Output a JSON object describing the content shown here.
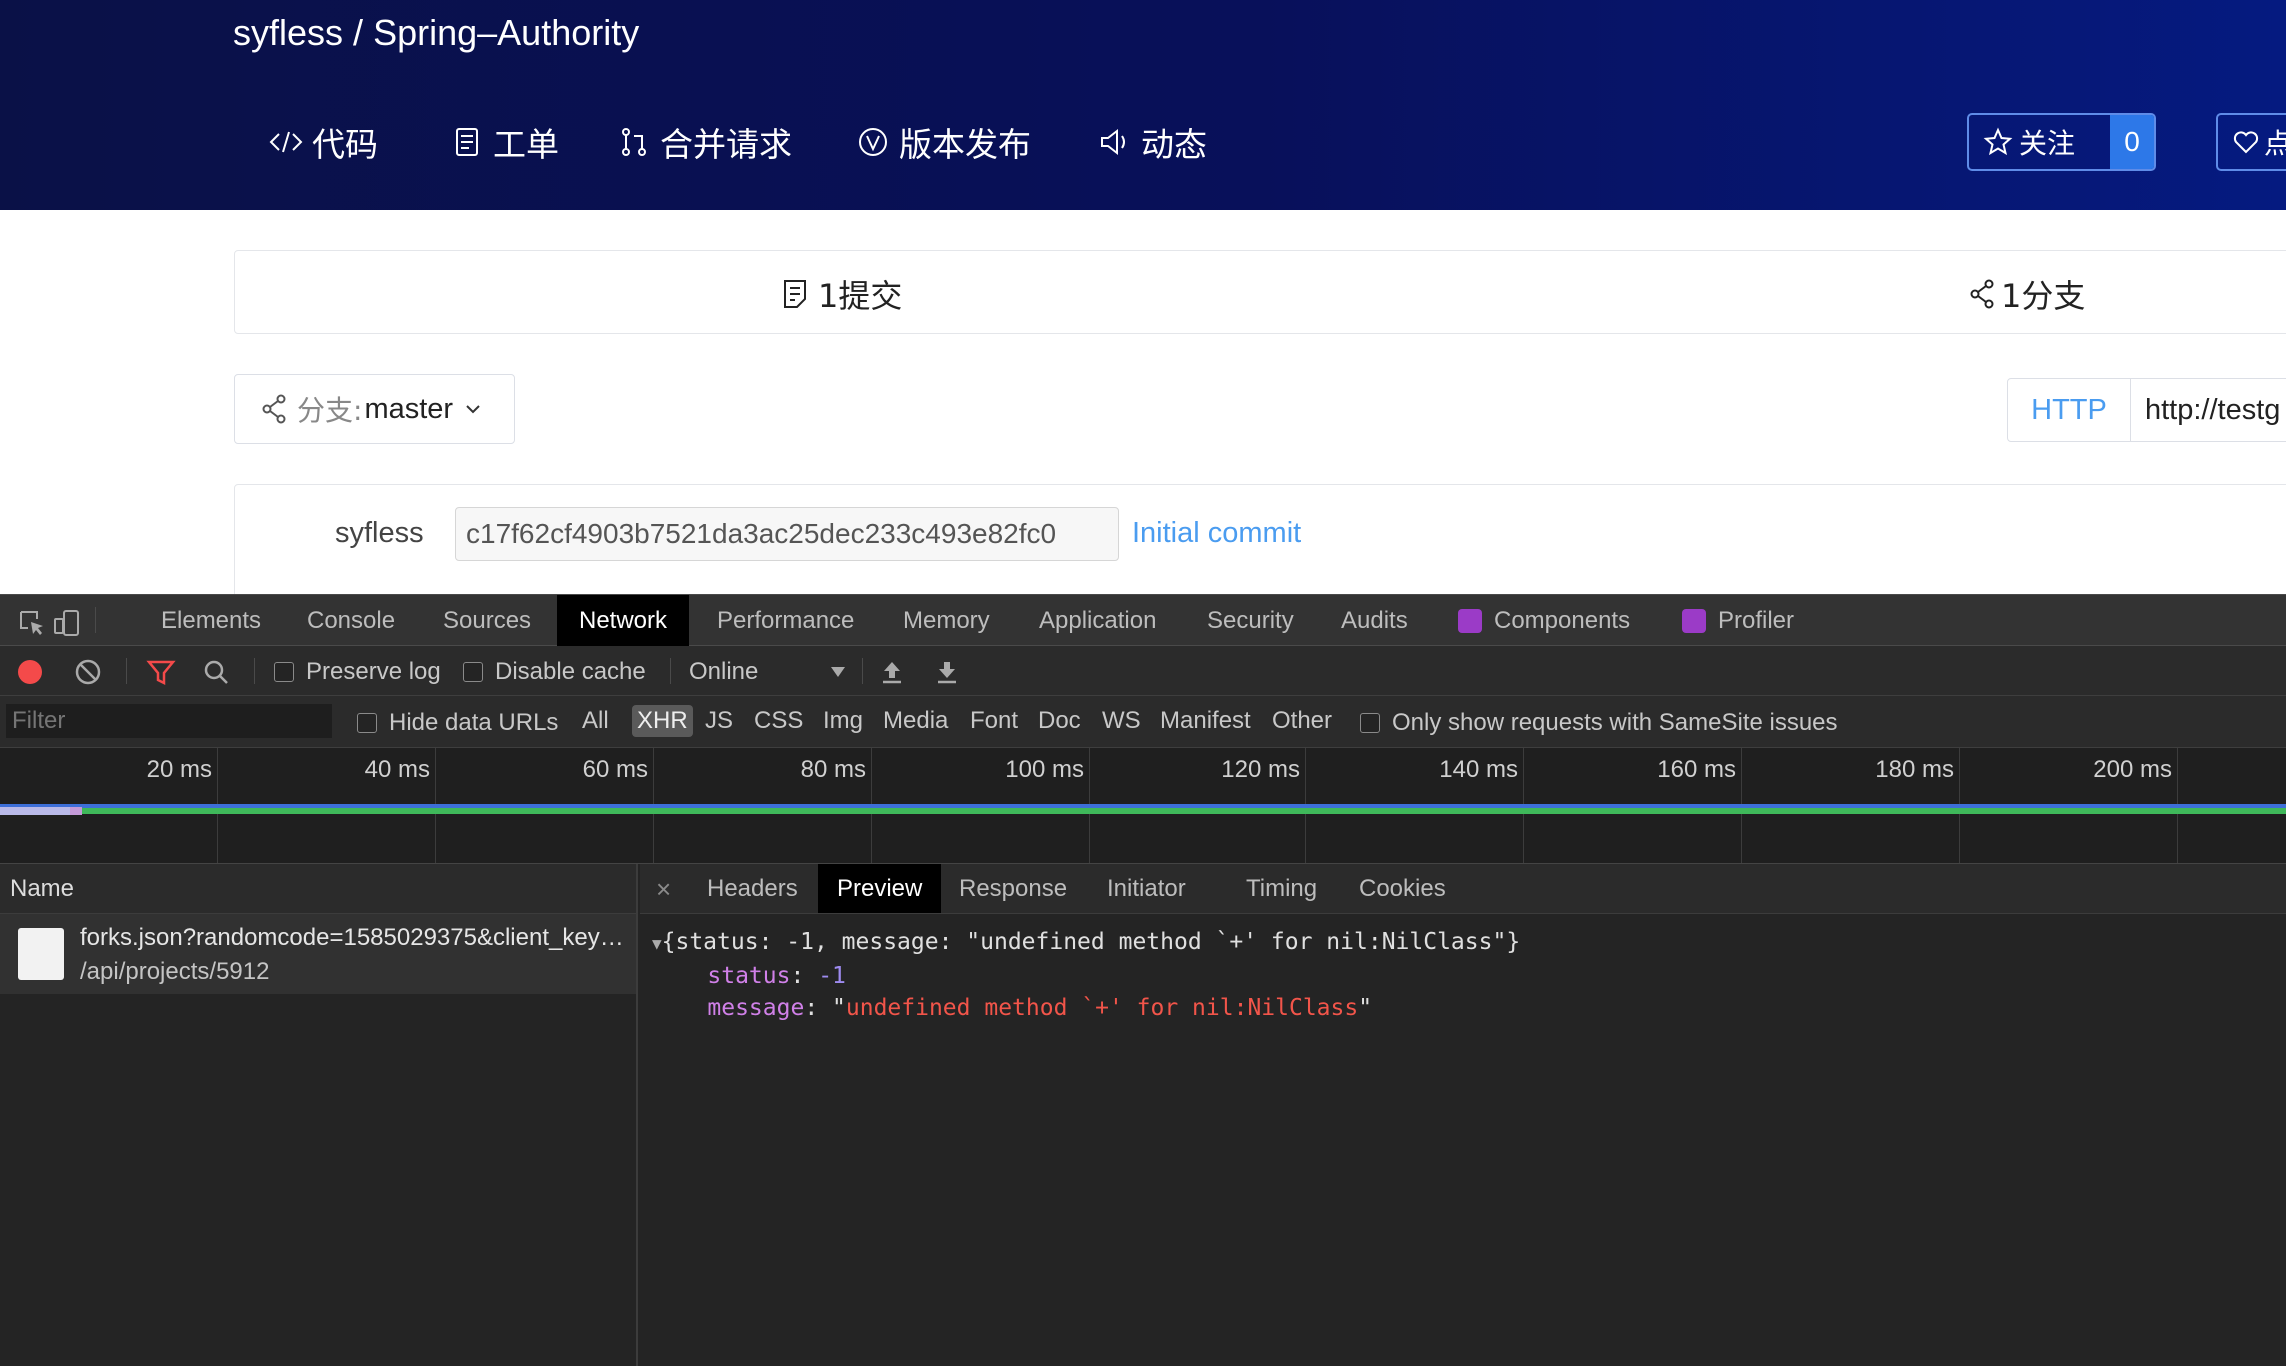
{
  "repo": {
    "owner": "syfless",
    "separator": "/",
    "name": "Spring–Authority"
  },
  "nav": [
    {
      "icon": "code-icon",
      "label": "代码"
    },
    {
      "icon": "issue-icon",
      "label": "工单"
    },
    {
      "icon": "pull-request-icon",
      "label": "合并请求"
    },
    {
      "icon": "release-icon",
      "label": "版本发布"
    },
    {
      "icon": "activity-icon",
      "label": "动态"
    }
  ],
  "watch": {
    "label": "关注",
    "count": "0"
  },
  "like": {
    "label": "点"
  },
  "stats": {
    "commits": "1提交",
    "branches": "1分支"
  },
  "branch": {
    "prefix": "分支:",
    "value": "master"
  },
  "clone": {
    "protocol": "HTTP",
    "url": "http://testg"
  },
  "commit": {
    "author": "syfless",
    "hash": "c17f62cf4903b7521da3ac25dec233c493e82fc0",
    "message": "Initial commit"
  },
  "devtools": {
    "tabs": [
      "Elements",
      "Console",
      "Sources",
      "Network",
      "Performance",
      "Memory",
      "Application",
      "Security",
      "Audits",
      "Components",
      "Profiler"
    ],
    "active_tab": "Network",
    "toolbar": {
      "preserve_log": "Preserve log",
      "disable_cache": "Disable cache",
      "throttle": "Online"
    },
    "filter": {
      "placeholder": "Filter",
      "hide_data_urls": "Hide data URLs",
      "types": [
        "All",
        "XHR",
        "JS",
        "CSS",
        "Img",
        "Media",
        "Font",
        "Doc",
        "WS",
        "Manifest",
        "Other"
      ],
      "active_type": "XHR",
      "samesite": "Only show requests with SameSite issues"
    },
    "timeline_ticks": [
      "20 ms",
      "40 ms",
      "60 ms",
      "80 ms",
      "100 ms",
      "120 ms",
      "140 ms",
      "160 ms",
      "180 ms",
      "200 ms"
    ],
    "name_header": "Name",
    "request": {
      "name": "forks.json?randomcode=1585029375&client_key=...",
      "path": "/api/projects/5912"
    },
    "detail_tabs": [
      "Headers",
      "Preview",
      "Response",
      "Initiator",
      "Timing",
      "Cookies"
    ],
    "active_detail_tab": "Preview",
    "preview": {
      "summary": "{status: -1, message: \"undefined method `+' for nil:NilClass\"}",
      "status_key": "status",
      "status_value": "-1",
      "message_key": "message",
      "message_value": "undefined method `+' for nil:NilClass"
    }
  },
  "colors": {
    "banner": "#08105a",
    "accent": "#2d78e8",
    "link": "#4a9cf0",
    "error_string": "#f2554a"
  }
}
